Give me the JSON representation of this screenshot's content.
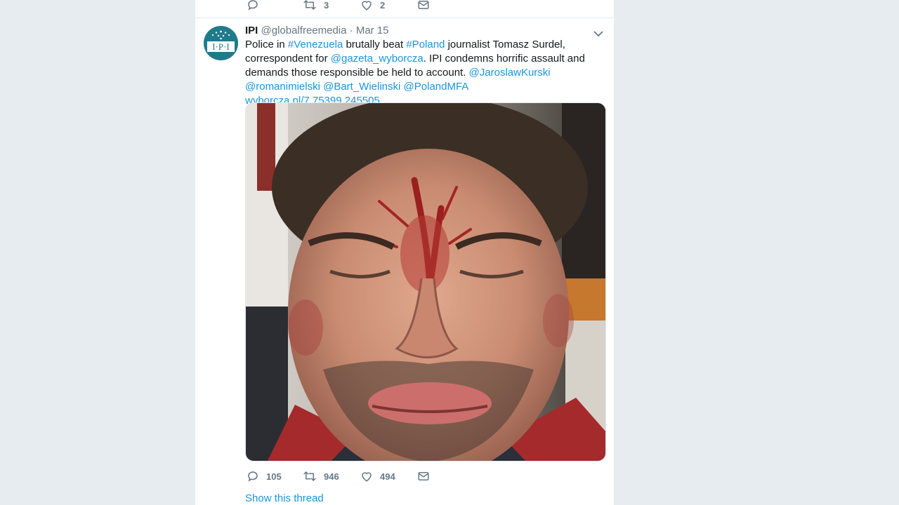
{
  "previous_tweet": {
    "retweet_count": "3",
    "like_count": "2"
  },
  "tweet": {
    "author_name": "IPI",
    "author_handle": "@globalfreemedia",
    "separator": "·",
    "date": "Mar 15",
    "avatar_text": "I·P·I",
    "text_segments": [
      {
        "text": "Police in ",
        "link": false
      },
      {
        "text": "#Venezuela",
        "link": true
      },
      {
        "text": " brutally beat ",
        "link": false
      },
      {
        "text": "#Poland",
        "link": true
      },
      {
        "text": " journalist Tomasz Surdel, correspondent for ",
        "link": false
      },
      {
        "text": "@gazeta_wyborcza",
        "link": true
      },
      {
        "text": ". IPI condemns horrific assault and demands those responsible be held to account. ",
        "link": false
      },
      {
        "text": "@JaroslawKurski",
        "link": true
      },
      {
        "text": " ",
        "link": false
      },
      {
        "text": "@romanimielski",
        "link": true
      },
      {
        "text": " ",
        "link": false
      },
      {
        "text": "@Bart_Wielinski",
        "link": true
      },
      {
        "text": " ",
        "link": false
      },
      {
        "text": "@PolandMFA",
        "link": true
      },
      {
        "text": " ",
        "link": false
      },
      {
        "text": "wyborcza.pl/7,75399,245505…",
        "link": true
      }
    ],
    "reply_count": "105",
    "retweet_count": "946",
    "like_count": "494",
    "show_thread_label": "Show this thread"
  },
  "colors": {
    "link": "#1b95e0",
    "muted": "#657786",
    "background": "#e6ecf0",
    "avatar": "#1f7a8c"
  }
}
